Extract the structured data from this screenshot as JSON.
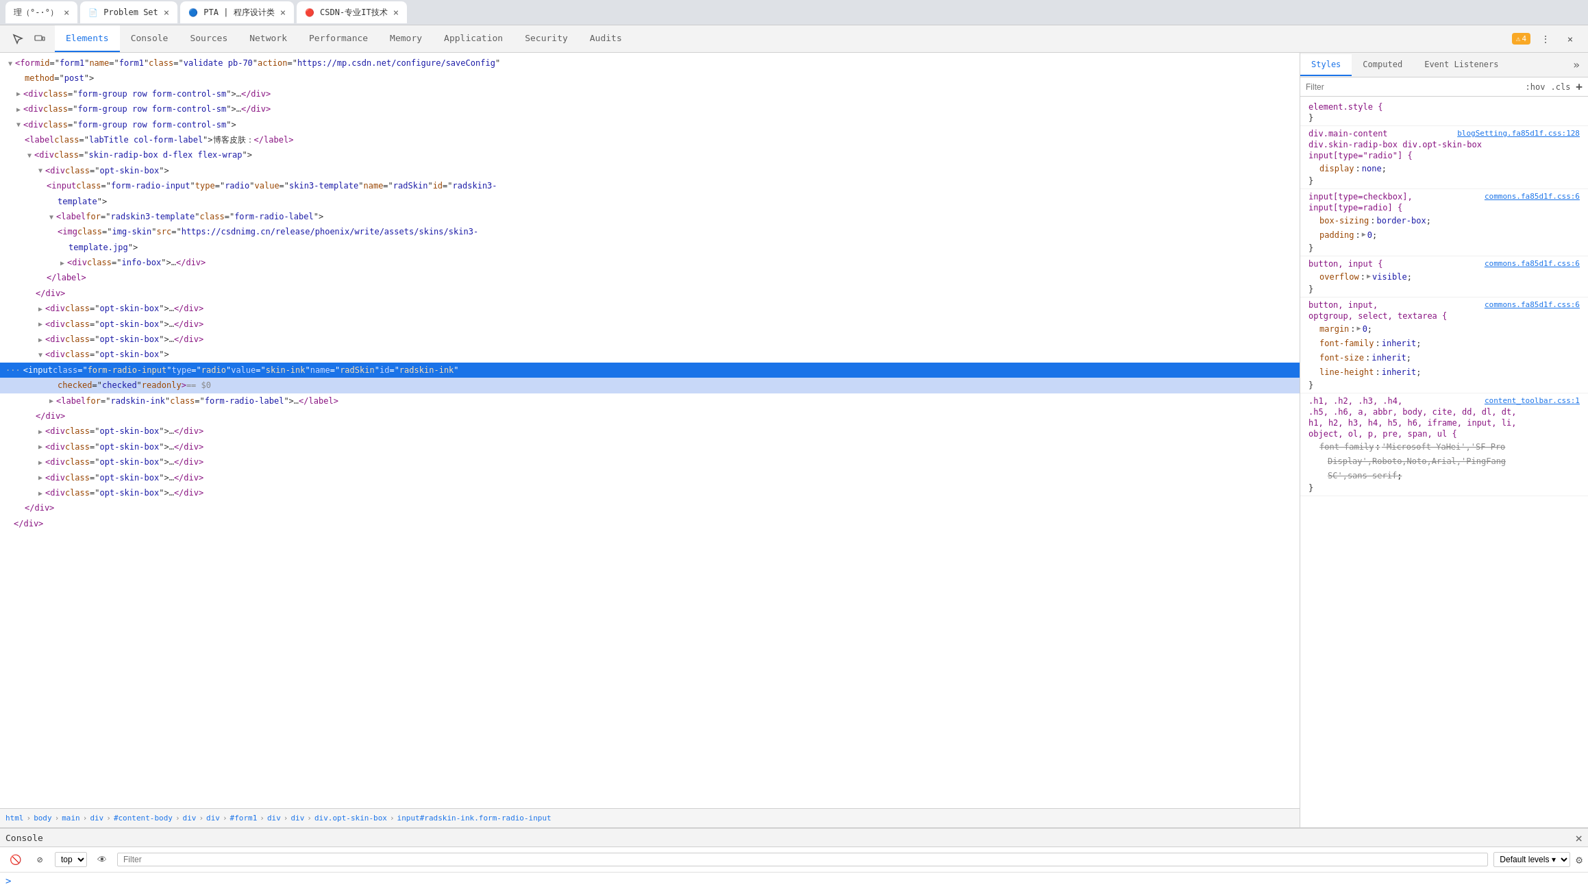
{
  "browser": {
    "tabs": [
      {
        "id": "tab1",
        "label": "理（°-·°）",
        "active": false
      },
      {
        "id": "tab2",
        "label": "Problem Set",
        "favicon": "📄",
        "active": false
      },
      {
        "id": "tab3",
        "label": "PTA | 程序设计类",
        "favicon": "🔵",
        "active": false
      },
      {
        "id": "tab4",
        "label": "CSDN-专业IT技术",
        "favicon": "🔴",
        "active": true
      }
    ]
  },
  "devtools": {
    "nav": {
      "tabs": [
        {
          "id": "elements",
          "label": "Elements",
          "active": true
        },
        {
          "id": "console",
          "label": "Console",
          "active": false
        },
        {
          "id": "sources",
          "label": "Sources",
          "active": false
        },
        {
          "id": "network",
          "label": "Network",
          "active": false
        },
        {
          "id": "performance",
          "label": "Performance",
          "active": false
        },
        {
          "id": "memory",
          "label": "Memory",
          "active": false
        },
        {
          "id": "application",
          "label": "Application",
          "active": false
        },
        {
          "id": "security",
          "label": "Security",
          "active": false
        },
        {
          "id": "audits",
          "label": "Audits",
          "active": false
        }
      ],
      "warning_count": "4"
    },
    "dom": {
      "lines": [
        {
          "id": "l1",
          "indent": 0,
          "expanded": true,
          "html": "<span class='tag'>&lt;form</span> <span class='attr-name'>id</span>=<span class='attr-value'>\"form1\"</span> <span class='attr-name'>name</span>=<span class='attr-value'>\"form1\"</span> <span class='attr-name'>class</span>=<span class='attr-value'>\"validate pb-70\"</span> <span class='attr-name'>action</span>=<span class='attr-value'>\"https://mp.csdn.net/configure/saveConfig\"</span>",
          "selected": false
        },
        {
          "id": "l1b",
          "indent": 1,
          "html": "<span class='attr-name'>method</span>=<span class='attr-value'>\"post\"</span><span class='tag'>&gt;</span>",
          "selected": false
        },
        {
          "id": "l2",
          "indent": 1,
          "expanded": false,
          "html": "<span class='tag'>▶ &lt;div</span> <span class='attr-name'>class</span>=<span class='attr-value'>\"form-group row form-control-sm\"</span><span class='tag'>&gt;…&lt;/div&gt;</span>",
          "selected": false
        },
        {
          "id": "l3",
          "indent": 1,
          "expanded": false,
          "html": "<span class='tag'>▶ &lt;div</span> <span class='attr-name'>class</span>=<span class='attr-value'>\"form-group row form-control-sm\"</span><span class='tag'>&gt;…&lt;/div&gt;</span>",
          "selected": false
        },
        {
          "id": "l4",
          "indent": 1,
          "expanded": true,
          "html": "<span class='tag'>▼ &lt;div</span> <span class='attr-name'>class</span>=<span class='attr-value'>\"form-group row form-control-sm\"</span><span class='tag'>&gt;</span>",
          "selected": false
        },
        {
          "id": "l5",
          "indent": 2,
          "html": "<span class='tag'>&lt;label</span> <span class='attr-name'>class</span>=<span class='attr-value'>\"labTitle col-form-label\"</span><span class='tag'>&gt;</span>博客皮肤：<span class='tag'>&lt;/label&gt;</span>",
          "selected": false
        },
        {
          "id": "l6",
          "indent": 2,
          "expanded": true,
          "html": "<span class='tag'>▼ &lt;div</span> <span class='attr-name'>class</span>=<span class='attr-value'>\"skin-radip-box d-flex flex-wrap\"</span><span class='tag'>&gt;</span>",
          "selected": false
        },
        {
          "id": "l7",
          "indent": 3,
          "expanded": true,
          "html": "<span class='tag'>▼ &lt;div</span> <span class='attr-name'>class</span>=<span class='attr-value'>\"opt-skin-box\"</span><span class='tag'>&gt;</span>",
          "selected": false
        },
        {
          "id": "l8",
          "indent": 4,
          "html": "<span class='tag'>&lt;input</span> <span class='attr-name'>class</span>=<span class='attr-value'>\"form-radio-input\"</span> <span class='attr-name'>type</span>=<span class='attr-value'>\"radio\"</span> <span class='attr-name'>value</span>=<span class='attr-value'>\"skin3-template\"</span> <span class='attr-name'>name</span>=<span class='attr-value'>\"radSkin\"</span> <span class='attr-name'>id</span>=<span class='attr-value'>\"radskin3-</span>",
          "selected": false
        },
        {
          "id": "l8b",
          "indent": 5,
          "html": "<span class='attr-value'>template\"</span><span class='tag'>&gt;</span>",
          "selected": false
        },
        {
          "id": "l9",
          "indent": 4,
          "expanded": true,
          "html": "<span class='tag'>▼ &lt;label</span> <span class='attr-name'>for</span>=<span class='attr-value'>\"radskin3-template\"</span> <span class='attr-name'>class</span>=<span class='attr-value'>\"form-radio-label\"</span><span class='tag'>&gt;</span>",
          "selected": false
        },
        {
          "id": "l10",
          "indent": 5,
          "html": "<span class='tag'>&lt;img</span> <span class='attr-name'>class</span>=<span class='attr-value'>\"img-skin\"</span> <span class='attr-name'>src</span>=<span class='attr-value'>\"<a>https://csdnimg.cn/release/phoenix/write/assets/skins/skin3-</a></span>",
          "selected": false
        },
        {
          "id": "l10b",
          "indent": 6,
          "html": "<span class='attr-value'><a>template.jpg</a>\"</span><span class='tag'>&gt;</span>",
          "selected": false
        },
        {
          "id": "l11",
          "indent": 5,
          "expanded": false,
          "html": "<span class='tag'>▶ &lt;div</span> <span class='attr-name'>class</span>=<span class='attr-value'>\"info-box\"</span><span class='tag'>&gt;…&lt;/div&gt;</span>",
          "selected": false
        },
        {
          "id": "l12",
          "indent": 4,
          "html": "<span class='tag'>&lt;/label&gt;</span>",
          "selected": false
        },
        {
          "id": "l13",
          "indent": 3,
          "html": "<span class='tag'>&lt;/div&gt;</span>",
          "selected": false
        },
        {
          "id": "l14",
          "indent": 3,
          "expanded": false,
          "html": "<span class='tag'>▶ &lt;div</span> <span class='attr-name'>class</span>=<span class='attr-value'>\"opt-skin-box\"</span><span class='tag'>&gt;…&lt;/div&gt;</span>",
          "selected": false
        },
        {
          "id": "l15",
          "indent": 3,
          "expanded": false,
          "html": "<span class='tag'>▶ &lt;div</span> <span class='attr-name'>class</span>=<span class='attr-value'>\"opt-skin-box\"</span><span class='tag'>&gt;…&lt;/div&gt;</span>",
          "selected": false
        },
        {
          "id": "l16",
          "indent": 3,
          "expanded": false,
          "html": "<span class='tag'>▶ &lt;div</span> <span class='attr-name'>class</span>=<span class='attr-value'>\"opt-skin-box\"</span><span class='tag'>&gt;…&lt;/div&gt;</span>",
          "selected": false
        },
        {
          "id": "l17",
          "indent": 3,
          "expanded": true,
          "html": "<span class='tag'>▼ &lt;div</span> <span class='attr-name'>class</span>=<span class='attr-value'>\"opt-skin-box\"</span><span class='tag'>&gt;</span>",
          "selected": true
        },
        {
          "id": "l18",
          "indent": 4,
          "selected_line": true,
          "html": "<span class='tag'>&lt;input</span> <span class='attr-name'>class</span>=<span class='attr-value'>\"form-radio-input\"</span> <span class='attr-name'>type</span>=<span class='attr-value'>\"radio\"</span> <span class='attr-name'>value</span>=<span class='attr-value'>\"skin-ink\"</span> <span class='attr-name'>name</span>=<span class='attr-value'>\"radSkin\"</span> <span class='attr-name'>id</span>=<span class='attr-value'>\"radskin-ink\"</span>",
          "selected": false
        },
        {
          "id": "l18b",
          "indent": 5,
          "html": "<span class='attr-name'>checked</span>=<span class='attr-value'>\"checked\"</span> <span class='attr-name'>readonly</span><span class='tag'>&gt;</span> == $0",
          "selected": false,
          "is_selected_indicator": true
        },
        {
          "id": "l19",
          "indent": 4,
          "expanded": false,
          "html": "<span class='tag'>▶ &lt;label</span> <span class='attr-name'>for</span>=<span class='attr-value'>\"radskin-ink\"</span> <span class='attr-name'>class</span>=<span class='attr-value'>\"form-radio-label\"</span><span class='tag'>&gt;…&lt;/label&gt;</span>",
          "selected": false
        },
        {
          "id": "l20",
          "indent": 3,
          "html": "<span class='tag'>&lt;/div&gt;</span>",
          "selected": false
        },
        {
          "id": "l21",
          "indent": 3,
          "expanded": false,
          "html": "<span class='tag'>▶ &lt;div</span> <span class='attr-name'>class</span>=<span class='attr-value'>\"opt-skin-box\"</span><span class='tag'>&gt;…&lt;/div&gt;</span>",
          "selected": false
        },
        {
          "id": "l22",
          "indent": 3,
          "expanded": false,
          "html": "<span class='tag'>▶ &lt;div</span> <span class='attr-name'>class</span>=<span class='attr-value'>\"opt-skin-box\"</span><span class='tag'>&gt;…&lt;/div&gt;</span>",
          "selected": false
        },
        {
          "id": "l23",
          "indent": 3,
          "expanded": false,
          "html": "<span class='tag'>▶ &lt;div</span> <span class='attr-name'>class</span>=<span class='attr-value'>\"opt-skin-box\"</span><span class='tag'>&gt;…&lt;/div&gt;</span>",
          "selected": false
        },
        {
          "id": "l24",
          "indent": 3,
          "expanded": false,
          "html": "<span class='tag'>▶ &lt;div</span> <span class='attr-name'>class</span>=<span class='attr-value'>\"opt-skin-box\"</span><span class='tag'>&gt;…&lt;/div&gt;</span>",
          "selected": false
        },
        {
          "id": "l25",
          "indent": 3,
          "expanded": false,
          "html": "<span class='tag'>▶ &lt;div</span> <span class='attr-name'>class</span>=<span class='attr-value'>\"opt-skin-box\"</span><span class='tag'>&gt;…&lt;/div&gt;</span>",
          "selected": false
        },
        {
          "id": "l26",
          "indent": 2,
          "html": "<span class='tag'>&lt;/div&gt;</span>",
          "selected": false
        },
        {
          "id": "l27",
          "indent": 1,
          "html": "<span class='tag'>&lt;/div&gt;</span>",
          "selected": false
        }
      ]
    },
    "breadcrumb": {
      "items": [
        "html",
        "body",
        "main",
        "div",
        "#content-body",
        "div",
        "div",
        "#form1",
        "div",
        "div",
        "div.opt-skin-box",
        "input#radskin-ink.form-radio-input"
      ]
    },
    "styles": {
      "filter_placeholder": "Filter",
      "hov_label": ":hov",
      "cls_label": ".cls",
      "tabs": [
        "Styles",
        "Computed",
        "Event Listeners"
      ],
      "rules": [
        {
          "selector": "element.style {",
          "closing": "}",
          "props": [],
          "source": null
        },
        {
          "selector": "div.main-content",
          "source_label": "blogSetting.fa85d1f.css:128",
          "second_selector": "div.skin-radip-box div.opt-skin-box",
          "third_selector": "input[type=\"radio\"] {",
          "closing": "}",
          "props": [
            {
              "name": "display",
              "value": "none",
              "semicolon": ";"
            }
          ]
        },
        {
          "selector": "input[type=checkbox],",
          "source_label": "commons.fa85d1f.css:6",
          "second_selector": "input[type=radio] {",
          "closing": "}",
          "props": [
            {
              "name": "box-sizing",
              "value": "border-box",
              "semicolon": ";"
            },
            {
              "name": "padding",
              "value": "▶ 0",
              "semicolon": ";"
            }
          ]
        },
        {
          "selector": "button, input {",
          "source_label": "commons.fa85d1f.css:6",
          "closing": "}",
          "props": [
            {
              "name": "overflow",
              "value": "▶ visible",
              "semicolon": ";"
            }
          ]
        },
        {
          "selector": "button, input,",
          "source_label": "commons.fa85d1f.css:6",
          "second_selector": "optgroup, select, textarea {",
          "closing": "}",
          "props": [
            {
              "name": "margin",
              "value": "▶ 0",
              "semicolon": ";"
            },
            {
              "name": "font-family",
              "value": "inherit",
              "semicolon": ";"
            },
            {
              "name": "font-size",
              "value": "inherit",
              "semicolon": ";"
            },
            {
              "name": "line-height",
              "value": "inherit",
              "semicolon": ";"
            }
          ]
        },
        {
          "selector": ".h1, .h2, .h3, .h4,",
          "source_label": "content_toolbar.css:1",
          "second_selector": ".h5, .h6, a, abbr, body, cite, dd, dl, dt,",
          "third_selector": "h1, h2, h3, h4, h5, h6, iframe, input, li,",
          "fourth_selector": "object, ol, p, pre, span, ul {",
          "closing": "}",
          "props": [
            {
              "name": "font-family",
              "value": "'Microsoft YaHei','SF Pro Display',Roboto,Noto,Arial,'PingFang SC',sans-serif",
              "semicolon": ";",
              "strikethrough": true
            }
          ]
        }
      ]
    },
    "console": {
      "title": "Console",
      "filter_placeholder": "Filter",
      "level_label": "Default levels",
      "top_label": "top"
    }
  }
}
